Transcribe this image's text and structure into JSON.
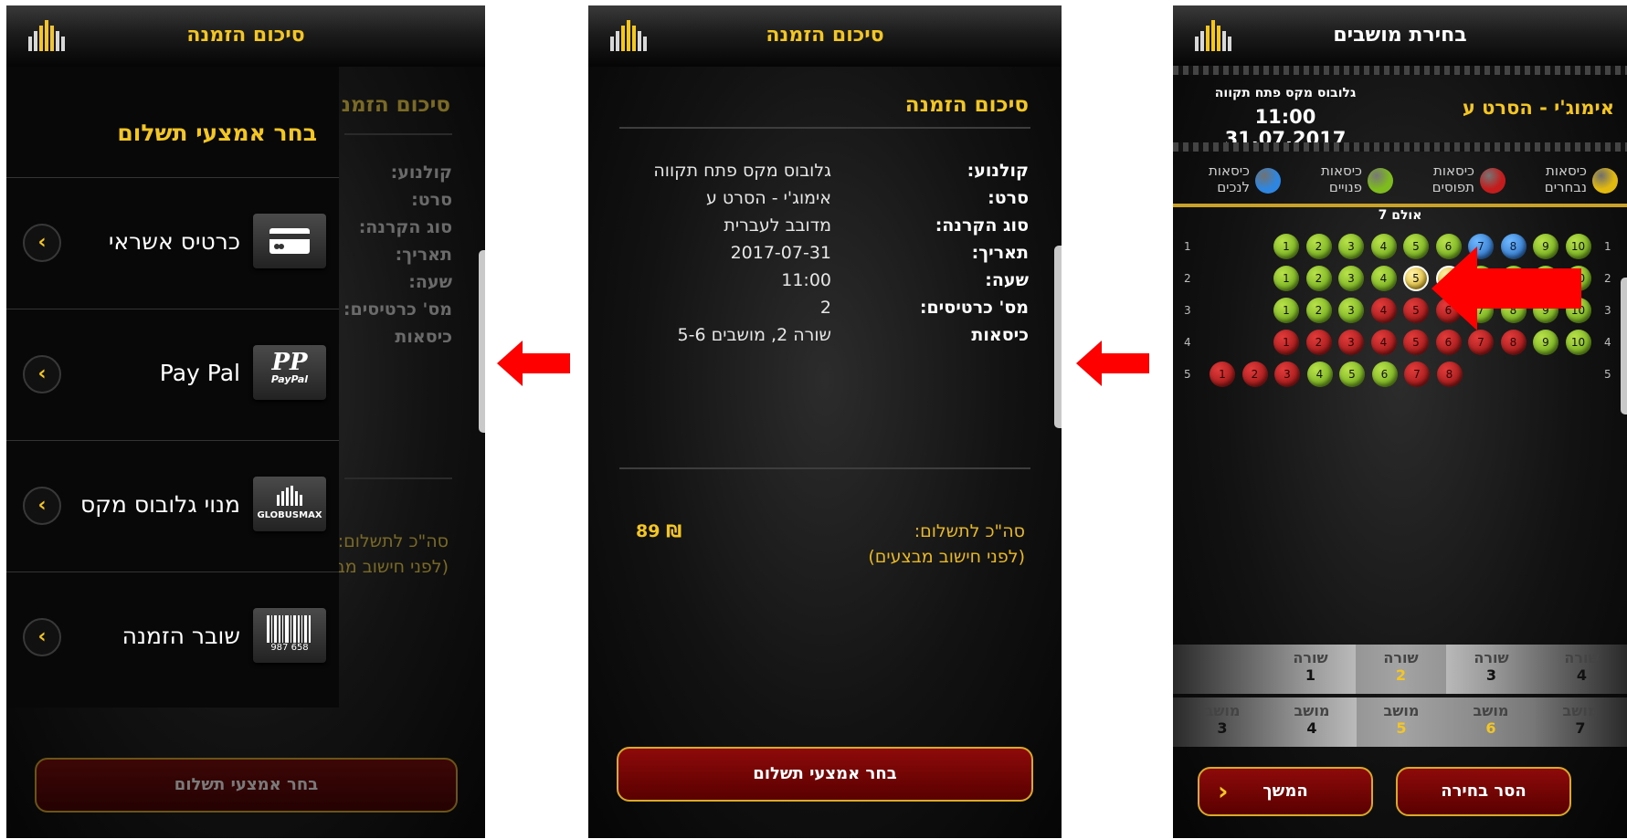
{
  "screens": {
    "left": {
      "title": "סיכום הזמנה",
      "bg_summary_title": "סיכום הזמנ",
      "bg_labels": [
        "קולנוע:",
        "סרט:",
        "סוג הקרנה:",
        "תאריך:",
        "שעה:",
        "מס' כרטיסים:",
        "כיסאות"
      ],
      "bg_total_label": "סה\"כ לתשלום:",
      "bg_total_note": "(לפני חישוב מב",
      "drawer_title": "בחר אמצעי תשלום",
      "payment_methods": [
        {
          "label": "כרטיס אשראי",
          "icon": "credit-card-icon"
        },
        {
          "label": "Pay Pal",
          "icon": "paypal-icon",
          "icon_text": "PP",
          "icon_sub": "PayPal"
        },
        {
          "label": "מנוי גלובוס מקס",
          "icon": "globusmax-icon",
          "icon_text": "GLOBUSMAX"
        },
        {
          "label": "שובר הזמנה",
          "icon": "barcode-icon",
          "icon_text": "987 658"
        }
      ],
      "button_label": "בחר אמצעי תשלום"
    },
    "middle": {
      "title": "סיכום הזמנה",
      "summary_title": "סיכום הזמנה",
      "rows": [
        {
          "label": "קולנוע:",
          "value": "גלובוס מקס פתח תקווה"
        },
        {
          "label": "סרט:",
          "value": "אימוג'י - הסרט ע"
        },
        {
          "label": "סוג הקרנה:",
          "value": "מדובב לעברית"
        },
        {
          "label": "תאריך:",
          "value": "2017-07-31"
        },
        {
          "label": "שעה:",
          "value": "11:00"
        },
        {
          "label": "מס' כרטיסים:",
          "value": "2"
        },
        {
          "label": "כיסאות",
          "value": "שורה 2, מושבים 5-6"
        }
      ],
      "total_label": "סה\"כ לתשלום:",
      "total_note": "(לפני חישוב מבצעים)",
      "total_price": "₪ 89",
      "button_label": "בחר אמצעי תשלום"
    },
    "right": {
      "title": "בחירת מושבים",
      "movie": "אימוג'י - הסרט ע",
      "cinema": "גלובוס מקס פתח תקווה",
      "datetime": "11:00 31.07.2017",
      "legend": [
        {
          "line1": "כיסאות",
          "line2": "נבחרים",
          "color": "#e2b90f"
        },
        {
          "line1": "כיסאות",
          "line2": "תפוסים",
          "color": "#c41c1c"
        },
        {
          "line1": "כיסאות",
          "line2": "פנויים",
          "color": "#7dbb1e"
        },
        {
          "line1": "כיסאות",
          "line2": "לנכים",
          "color": "#2e86e0"
        }
      ],
      "hall": "אולם 7",
      "seat_rows": [
        {
          "row": "1",
          "seats": [
            [
              "1",
              "free"
            ],
            [
              "2",
              "free"
            ],
            [
              "3",
              "free"
            ],
            [
              "4",
              "free"
            ],
            [
              "5",
              "free"
            ],
            [
              "6",
              "free"
            ],
            [
              "7",
              "dis"
            ],
            [
              "8",
              "dis"
            ],
            [
              "9",
              "free"
            ],
            [
              "10",
              "free"
            ]
          ]
        },
        {
          "row": "2",
          "seats": [
            [
              "1",
              "free"
            ],
            [
              "2",
              "free"
            ],
            [
              "3",
              "free"
            ],
            [
              "4",
              "free"
            ],
            [
              "5",
              "sel"
            ],
            [
              "6",
              "sel"
            ],
            [
              "7",
              "free"
            ],
            [
              "8",
              "free"
            ],
            [
              "9",
              "free"
            ],
            [
              "10",
              "free"
            ]
          ]
        },
        {
          "row": "3",
          "seats": [
            [
              "1",
              "free"
            ],
            [
              "2",
              "free"
            ],
            [
              "3",
              "free"
            ],
            [
              "4",
              "occ"
            ],
            [
              "5",
              "occ"
            ],
            [
              "6",
              "occ"
            ],
            [
              "7",
              "free"
            ],
            [
              "8",
              "free"
            ],
            [
              "9",
              "free"
            ],
            [
              "10",
              "free"
            ]
          ]
        },
        {
          "row": "4",
          "seats": [
            [
              "1",
              "occ"
            ],
            [
              "2",
              "occ"
            ],
            [
              "3",
              "occ"
            ],
            [
              "4",
              "occ"
            ],
            [
              "5",
              "occ"
            ],
            [
              "6",
              "occ"
            ],
            [
              "7",
              "occ"
            ],
            [
              "8",
              "occ"
            ],
            [
              "9",
              "free"
            ],
            [
              "10",
              "free"
            ]
          ]
        },
        {
          "row": "5",
          "seats": [
            [
              "1",
              "occ"
            ],
            [
              "2",
              "occ"
            ],
            [
              "3",
              "occ"
            ],
            [
              "4",
              "free"
            ],
            [
              "5",
              "free"
            ],
            [
              "6",
              "free"
            ],
            [
              "7",
              "occ"
            ],
            [
              "8",
              "occ"
            ]
          ]
        }
      ],
      "row_picker": {
        "label": "שורה",
        "values": [
          "4",
          "3",
          "2",
          "1"
        ],
        "selected": "2"
      },
      "seat_picker": {
        "label": "מושב",
        "values": [
          "7",
          "6",
          "5",
          "4",
          "3"
        ],
        "selected": [
          "6",
          "5"
        ]
      },
      "clear_button": "הסר בחירה",
      "continue_button": "המשך"
    }
  },
  "colors": {
    "gold": "#f3c623",
    "button_red": "#7a0404",
    "arrow_red": "#ff0000"
  }
}
